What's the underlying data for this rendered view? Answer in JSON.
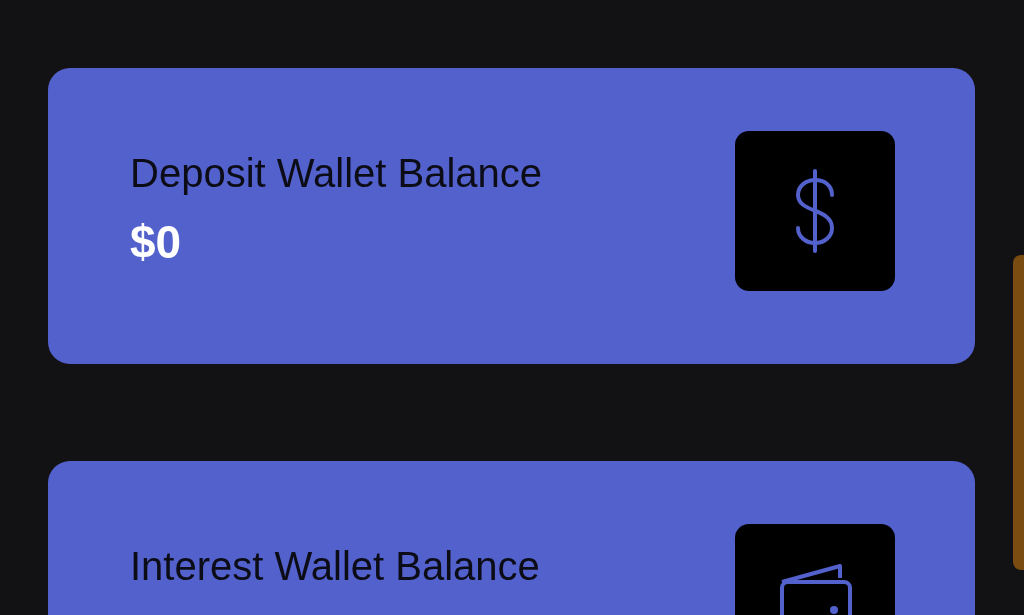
{
  "cards": [
    {
      "title": "Deposit Wallet Balance",
      "value": "$0",
      "kind": "dollar"
    },
    {
      "title": "Interest Wallet Balance",
      "kind": "wallet"
    }
  ]
}
